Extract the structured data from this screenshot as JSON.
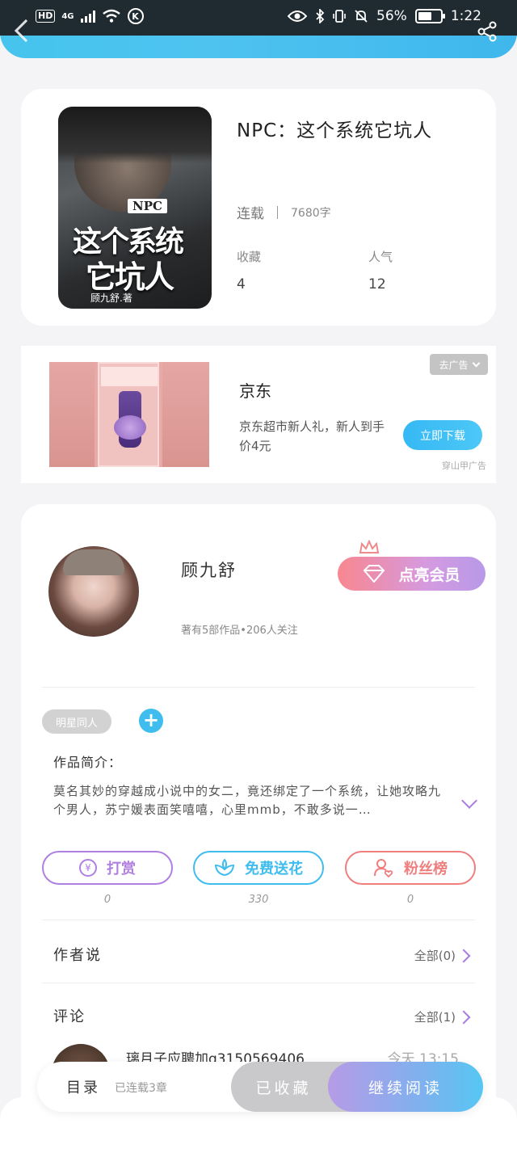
{
  "status_bar": {
    "hd": "HD",
    "network": "4G",
    "k_icon": "K",
    "battery_pct": "56%",
    "time": "1:22"
  },
  "book": {
    "cover": {
      "npc": "NPC",
      "line1": "这个系统",
      "line2": "它坑人",
      "author": "顾九舒.著"
    },
    "title": "NPC：这个系统它坑人",
    "status": "连载",
    "words": "7680字",
    "favorites_label": "收藏",
    "favorites": "4",
    "popularity_label": "人气",
    "popularity": "12"
  },
  "ad": {
    "close_label": "去广告",
    "brand": "京东",
    "desc": "京东超市新人礼，新人到手价4元",
    "button": "立即下载",
    "source": "穿山甲广告"
  },
  "author": {
    "name": "顾九舒",
    "stats": "著有5部作品•206人关注",
    "vip_button": "点亮会员"
  },
  "tags": [
    "明星同人"
  ],
  "intro": {
    "label": "作品简介：",
    "text": "莫名其妙的穿越成小说中的女二，竟还绑定了一个系统，让她攻略九个男人，苏宁媛表面笑嘻嘻，心里mmb，不敢多说一…"
  },
  "actions": [
    {
      "label": "打赏",
      "count": "0",
      "color": "#b07fe2",
      "icon": "yen-icon"
    },
    {
      "label": "免费送花",
      "count": "330",
      "color": "#3fbdee",
      "icon": "flower-icon"
    },
    {
      "label": "粉丝榜",
      "count": "0",
      "color": "#ef7f7f",
      "icon": "user-heart-icon"
    }
  ],
  "author_says": {
    "label": "作者说",
    "link": "全部(0)"
  },
  "comments": {
    "label": "评论",
    "link": "全部(1)",
    "first_user": "璃月子应聘加q3150569406",
    "first_time": "今天 13:15"
  },
  "bottom": {
    "toc": "目录",
    "chapters": "已连载3章",
    "saved": "已收藏",
    "read": "继续阅读"
  }
}
